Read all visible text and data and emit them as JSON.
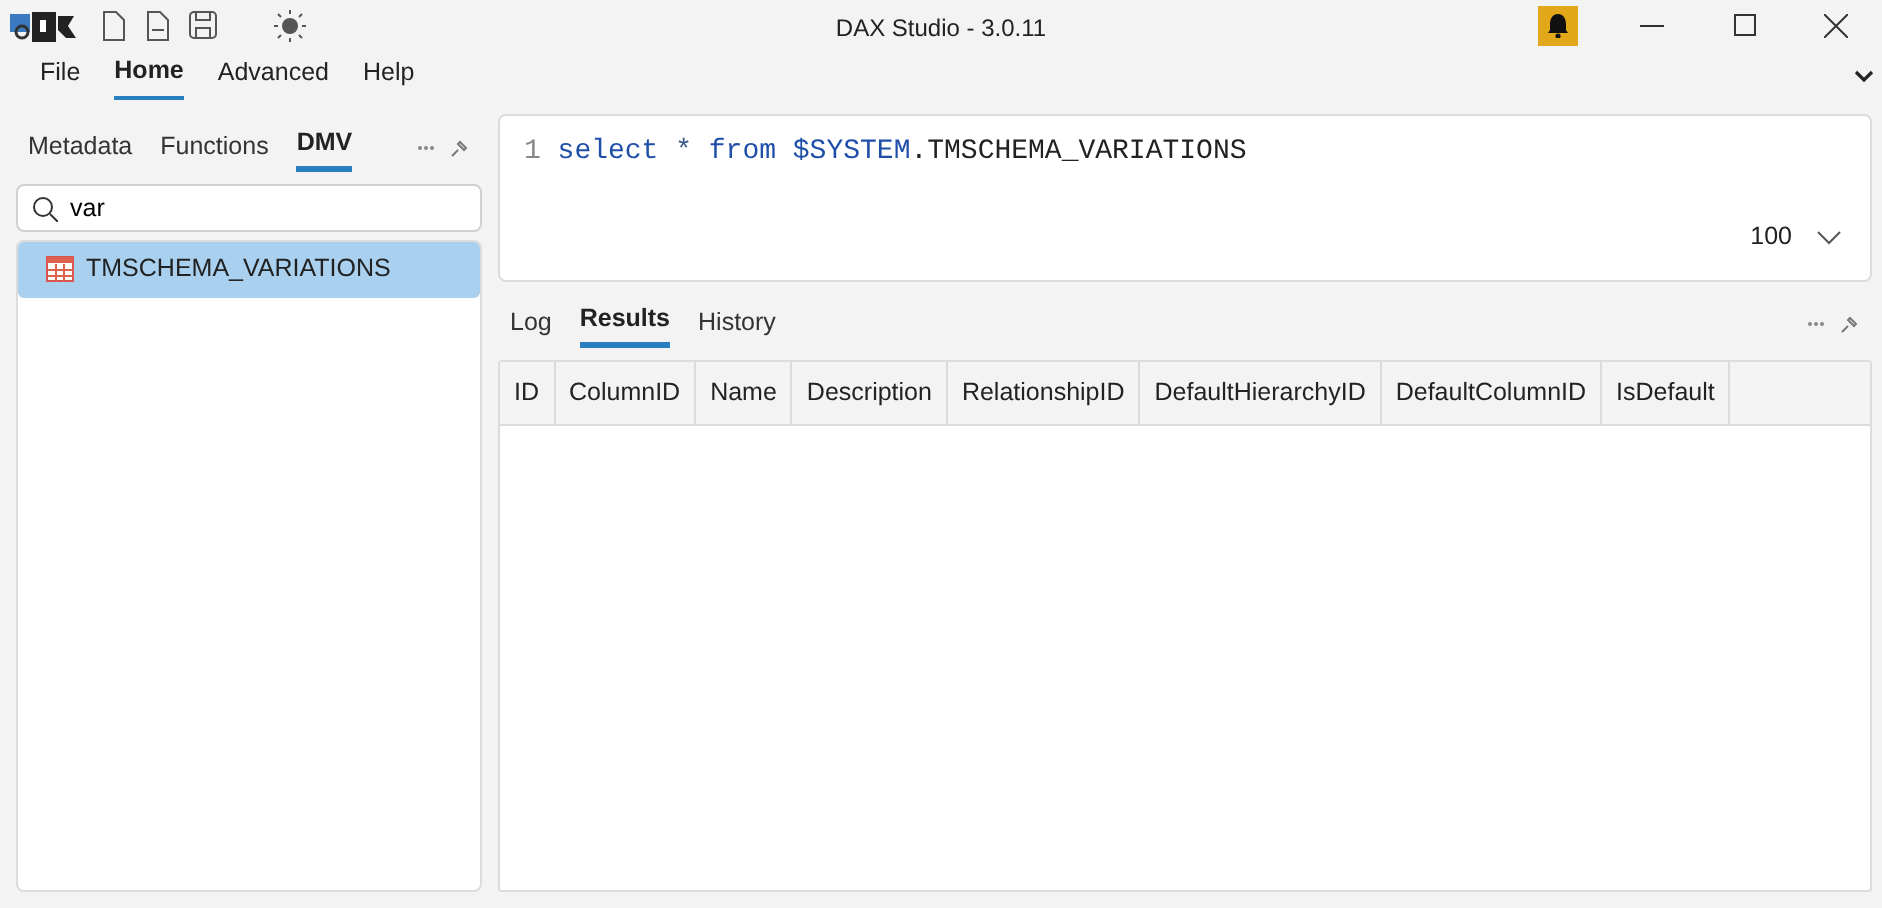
{
  "window": {
    "title": "DAX Studio - 3.0.11"
  },
  "menu": [
    {
      "label": "File",
      "selected": false
    },
    {
      "label": "Home",
      "selected": true
    },
    {
      "label": "Advanced",
      "selected": false
    },
    {
      "label": "Help",
      "selected": false
    }
  ],
  "sidebar": {
    "tabs": [
      {
        "label": "Metadata",
        "selected": false
      },
      {
        "label": "Functions",
        "selected": false
      },
      {
        "label": "DMV",
        "selected": true
      }
    ],
    "search": {
      "value": "var"
    },
    "items": [
      {
        "label": "TMSCHEMA_VARIATIONS",
        "selected": true
      }
    ]
  },
  "editor": {
    "line_number": "1",
    "tokens": [
      {
        "text": "select",
        "kind": "keyword"
      },
      {
        "text": "*",
        "kind": "operator"
      },
      {
        "text": "from",
        "kind": "keyword"
      },
      {
        "text": "$SYSTEM",
        "kind": "keyword"
      },
      {
        "text": ".TMSCHEMA_VARIATIONS",
        "kind": "identifier"
      }
    ],
    "row_limit": "100"
  },
  "output": {
    "tabs": [
      {
        "label": "Log",
        "selected": false
      },
      {
        "label": "Results",
        "selected": true
      },
      {
        "label": "History",
        "selected": false
      }
    ],
    "table": {
      "columns": [
        "ID",
        "ColumnID",
        "Name",
        "Description",
        "RelationshipID",
        "DefaultHierarchyID",
        "DefaultColumnID",
        "IsDefault"
      ]
    }
  }
}
